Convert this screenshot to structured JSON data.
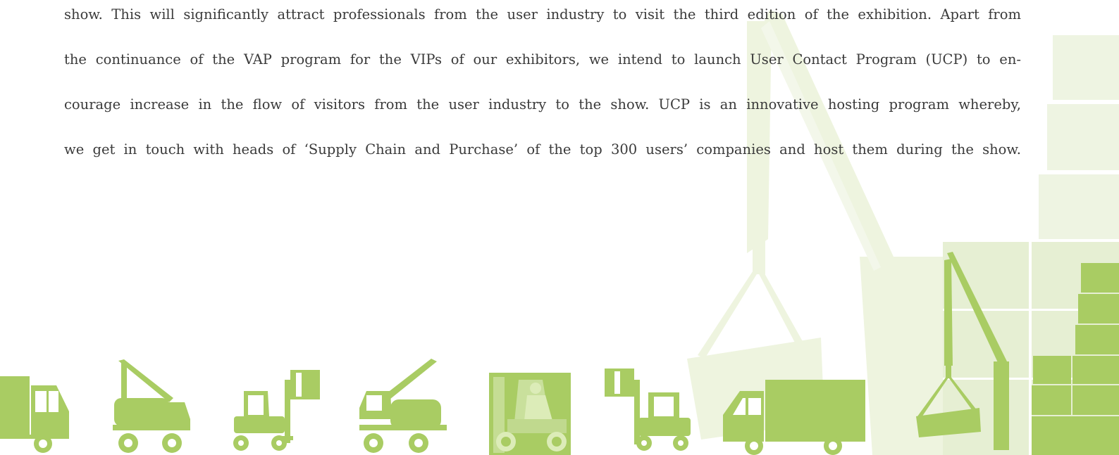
{
  "body_text": {
    "lines": [
      "show. This will significantly attract professionals from the user industry to visit the third edition of the exhibition. Apart from",
      "the continuance of the VAP program for the VIPs of our exhibitors, we intend to launch User Contact Program (UCP) to en-",
      "courage increase in the flow of visitors from the user industry to the show. UCP is an innovative hosting program whereby,",
      "we get in touch with heads of ‘Supply Chain and Purchase’ of the top 300 users’ companies and host them during the show."
    ]
  },
  "colors": {
    "text": "#3a3a3a",
    "icon_green": "#a9cc63",
    "pale_green": "#e8f0d6",
    "mid_green": "#d5e6b4"
  },
  "icons": [
    "truck-icon",
    "crane-truck-icon",
    "forklift-icon",
    "crane-truck-icon",
    "forklift-driver-photo",
    "forklift-icon",
    "box-truck-icon",
    "crane-lifting-cargo-icon",
    "stacked-boxes-icon"
  ]
}
